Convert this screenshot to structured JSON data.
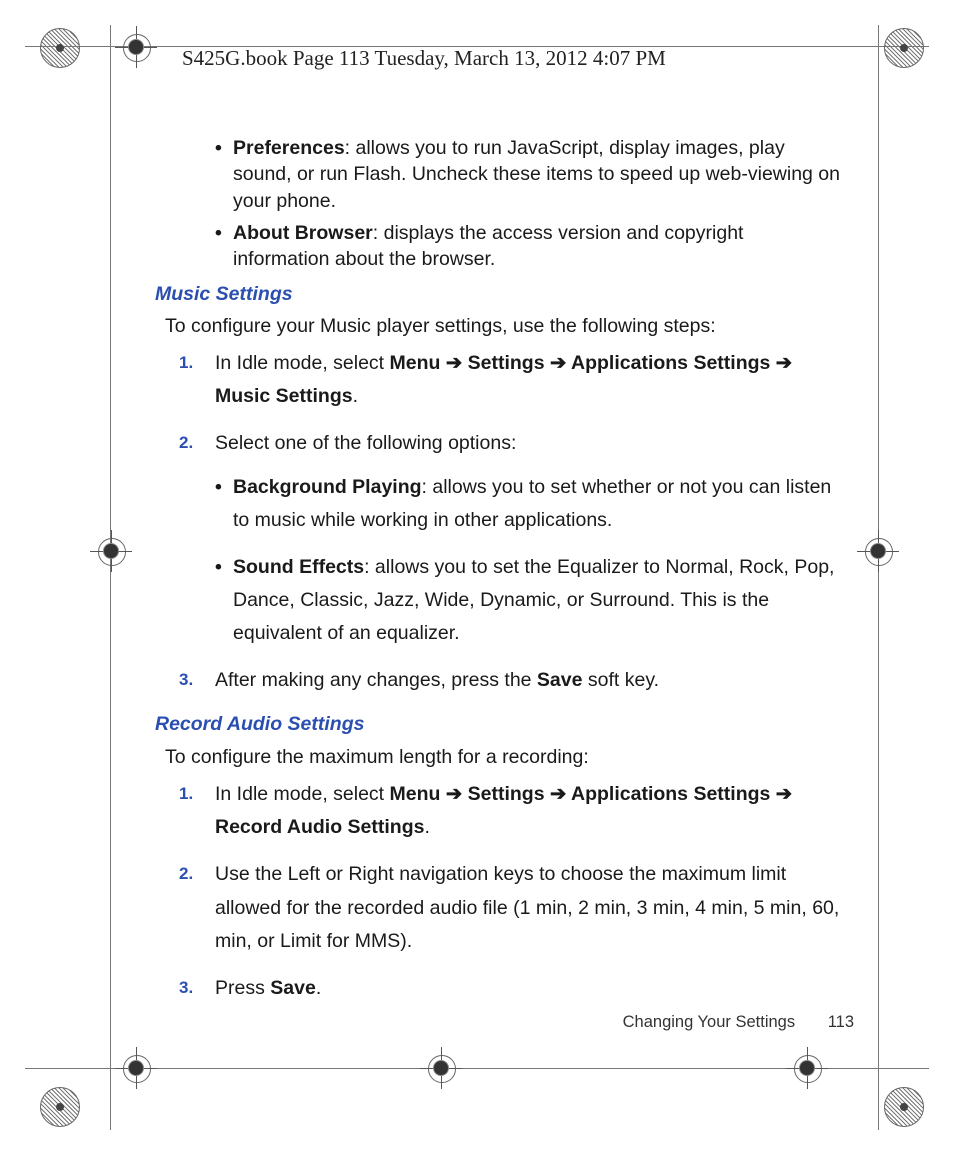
{
  "header": "S425G.book  Page 113  Tuesday, March 13, 2012  4:07 PM",
  "top_bullets": [
    {
      "label": "Preferences",
      "text": ": allows you to run JavaScript, display images, play sound, or run Flash. Uncheck these items to speed up web-viewing on your phone."
    },
    {
      "label": "About Browser",
      "text": ": displays the access version and copyright information about the browser."
    }
  ],
  "music": {
    "heading": "Music Settings",
    "intro": "To configure your Music player settings, use the following steps:",
    "steps": {
      "s1": {
        "n": "1.",
        "pre": "In Idle mode, select ",
        "menu": "Menu",
        "arr": " ➔ ",
        "settings": "Settings",
        "apps": "Applications Settings",
        "last": "Music Settings",
        "dot": "."
      },
      "s2": {
        "n": "2.",
        "text": "Select one of the following options:"
      },
      "bullets": [
        {
          "label": "Background Playing",
          "text": ": allows you to set whether or not you can listen to music while working in other applications."
        },
        {
          "label": "Sound Effects",
          "text": ": allows you to set the Equalizer to Normal, Rock, Pop, Dance, Classic, Jazz, Wide, Dynamic, or Surround. This is the equivalent of an equalizer."
        }
      ],
      "s3": {
        "n": "3.",
        "pre": "After making any changes, press the ",
        "save": "Save",
        "post": " soft key."
      }
    }
  },
  "record": {
    "heading": "Record Audio Settings",
    "intro": "To configure the maximum length for a recording:",
    "steps": {
      "s1": {
        "n": "1.",
        "pre": "In Idle mode, select ",
        "menu": "Menu",
        "arr": " ➔ ",
        "settings": "Settings",
        "apps": "Applications Settings",
        "rec": "Record Audio Settings",
        "dot": "."
      },
      "s2": {
        "n": "2.",
        "text": "Use the Left or Right navigation keys to choose the maximum limit allowed for the recorded audio file (1 min, 2 min, 3 min, 4 min, 5 min, 60, min, or Limit for MMS)."
      },
      "s3": {
        "n": "3.",
        "pre": "Press ",
        "save": "Save",
        "dot": "."
      }
    }
  },
  "footer": {
    "section": "Changing Your Settings",
    "page": "113"
  }
}
